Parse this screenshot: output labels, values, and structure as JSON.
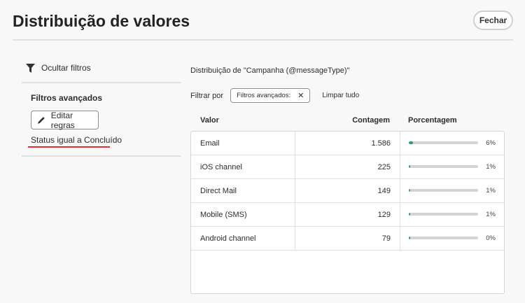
{
  "header": {
    "title": "Distribuição de valores",
    "close_label": "Fechar"
  },
  "sidebar": {
    "hide_filters": "Ocultar filtros",
    "advanced_title": "Filtros avançados",
    "edit_rules": "Editar regras",
    "rule": "Status igual a Concluído"
  },
  "main": {
    "distribution_title": "Distribuição de \"Campanha (@messageType)\"",
    "filter_by": "Filtrar por",
    "chip_label": "Filtros avançados:",
    "clear_all": "Limpar tudo",
    "columns": [
      "Valor",
      "Contagem",
      "Porcentagem"
    ],
    "rows": [
      {
        "value": "Email",
        "count": "1.586",
        "percent": "6%",
        "fraction": 0.06
      },
      {
        "value": "iOS channel",
        "count": "225",
        "percent": "1%",
        "fraction": 0.01
      },
      {
        "value": "Direct Mail",
        "count": "149",
        "percent": "1%",
        "fraction": 0.01
      },
      {
        "value": "Mobile (SMS)",
        "count": "129",
        "percent": "1%",
        "fraction": 0.01
      },
      {
        "value": "Android channel",
        "count": "79",
        "percent": "0%",
        "fraction": 0.0
      }
    ]
  },
  "colors": {
    "bar_fill": "#2d9d78",
    "underline": "#e03030"
  }
}
